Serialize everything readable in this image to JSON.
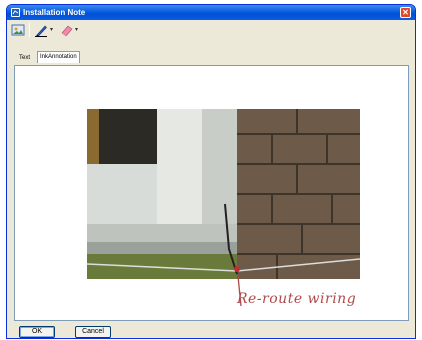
{
  "window": {
    "title": "Installation Note"
  },
  "toolbar": {
    "pen_tool": "pen-icon",
    "eraser_tool": "eraser-icon",
    "insert_image": "insert-image-icon"
  },
  "tabs": [
    {
      "label": "Text",
      "active": false
    },
    {
      "label": "InkAnnotation",
      "active": true
    }
  ],
  "annotation": {
    "text": "Re-route wiring",
    "color": "#b04a4a"
  },
  "buttons": {
    "ok": "OK",
    "cancel": "Cancel"
  }
}
